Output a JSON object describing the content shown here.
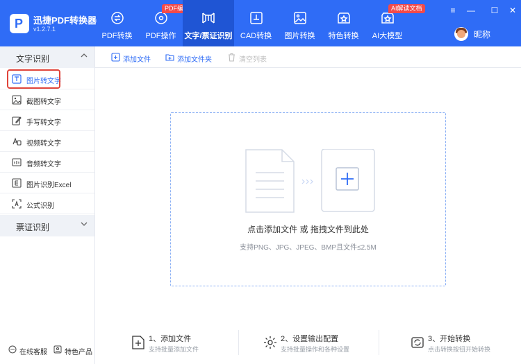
{
  "app": {
    "name": "迅捷PDF转换器",
    "version": "v1.2.7.1",
    "logo_letter": "P"
  },
  "nav": {
    "tabs": [
      {
        "label": "PDF转换",
        "icon": "convert-icon"
      },
      {
        "label": "PDF操作",
        "icon": "disc-icon",
        "badge": "PDF编辑"
      },
      {
        "label": "文字/票证识别",
        "icon": "text-recognition-icon",
        "active": true
      },
      {
        "label": "CAD转换",
        "icon": "cad-icon"
      },
      {
        "label": "图片转换",
        "icon": "image-icon"
      },
      {
        "label": "特色转换",
        "icon": "star-frame-icon"
      },
      {
        "label": "AI大模型",
        "icon": "ai-star-icon",
        "badge": "AI解读文档"
      }
    ]
  },
  "user": {
    "nickname": "昵称"
  },
  "window_controls": {
    "menu": "≡",
    "minimize": "—",
    "maximize": "☐",
    "close": "✕"
  },
  "sidebar": {
    "group1": {
      "title": "文字识别",
      "expanded": true
    },
    "items": [
      {
        "label": "图片转文字",
        "icon": "text-box-icon",
        "active": true
      },
      {
        "label": "截图转文字",
        "icon": "screenshot-icon"
      },
      {
        "label": "手写转文字",
        "icon": "handwriting-icon"
      },
      {
        "label": "视频转文字",
        "icon": "video-icon"
      },
      {
        "label": "音频转文字",
        "icon": "audio-icon"
      },
      {
        "label": "图片识别Excel",
        "icon": "excel-icon"
      },
      {
        "label": "公式识别",
        "icon": "formula-icon"
      }
    ],
    "group2": {
      "title": "票证识别",
      "expanded": false
    },
    "footer": {
      "support": "在线客服",
      "features": "特色产品"
    }
  },
  "toolbar": {
    "add_file": "添加文件",
    "add_folder": "添加文件夹",
    "clear_list": "清空列表"
  },
  "dropzone": {
    "title": "点击添加文件 或 拖拽文件到此处",
    "subtitle": "支持PNG、JPG、JPEG、BMP且文件≤2.5M"
  },
  "steps": [
    {
      "title": "1、添加文件",
      "desc": "支持批量添加文件",
      "icon": "add-file-icon"
    },
    {
      "title": "2、设置输出配置",
      "desc": "支持批量操作和各种设置",
      "icon": "settings-icon"
    },
    {
      "title": "3、开始转换",
      "desc": "点击转换按钮开始转换",
      "icon": "start-convert-icon"
    }
  ],
  "colors": {
    "brand": "#2f6cf6",
    "active_tab": "#1f55d4",
    "badge": "#f24a4a",
    "highlight": "#e0443a"
  }
}
